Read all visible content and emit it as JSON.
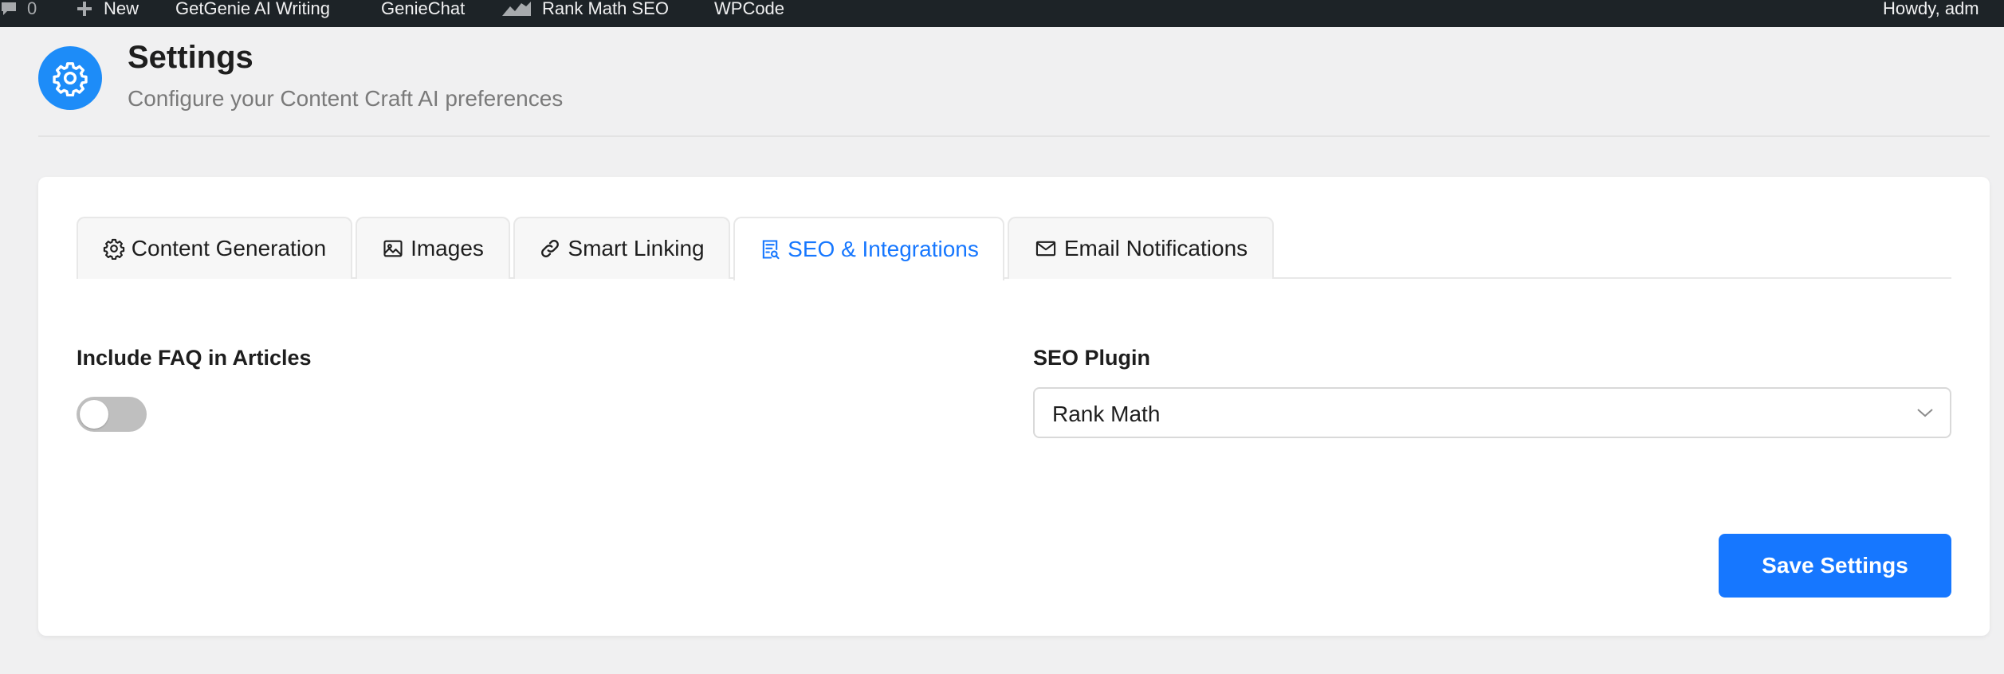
{
  "admin_bar": {
    "comments_count": "0",
    "new_label": "New",
    "getgenie_label": "GetGenie AI Writing",
    "geniechat_label": "GenieChat",
    "rankmath_label": "Rank Math SEO",
    "wpcode_label": "WPCode",
    "howdy_label": "Howdy, adm"
  },
  "header": {
    "title": "Settings",
    "subtitle": "Configure your Content Craft AI preferences",
    "icon": "gear-icon"
  },
  "tabs": [
    {
      "label": "Content Generation",
      "icon": "gear-icon",
      "active": false
    },
    {
      "label": "Images",
      "icon": "image-icon",
      "active": false
    },
    {
      "label": "Smart Linking",
      "icon": "link-icon",
      "active": false
    },
    {
      "label": "SEO & Integrations",
      "icon": "seo-document-icon",
      "active": true
    },
    {
      "label": "Email Notifications",
      "icon": "mail-icon",
      "active": false
    }
  ],
  "faq": {
    "label": "Include FAQ in Articles",
    "enabled": false
  },
  "seo_plugin": {
    "label": "SEO Plugin",
    "selected": "Rank Math"
  },
  "save_button_label": "Save Settings",
  "colors": {
    "accent": "#1677ff",
    "admin_bar": "#1d2327",
    "header_icon_bg": "#1d8cf8",
    "toggle_off": "#bfbfbf"
  }
}
